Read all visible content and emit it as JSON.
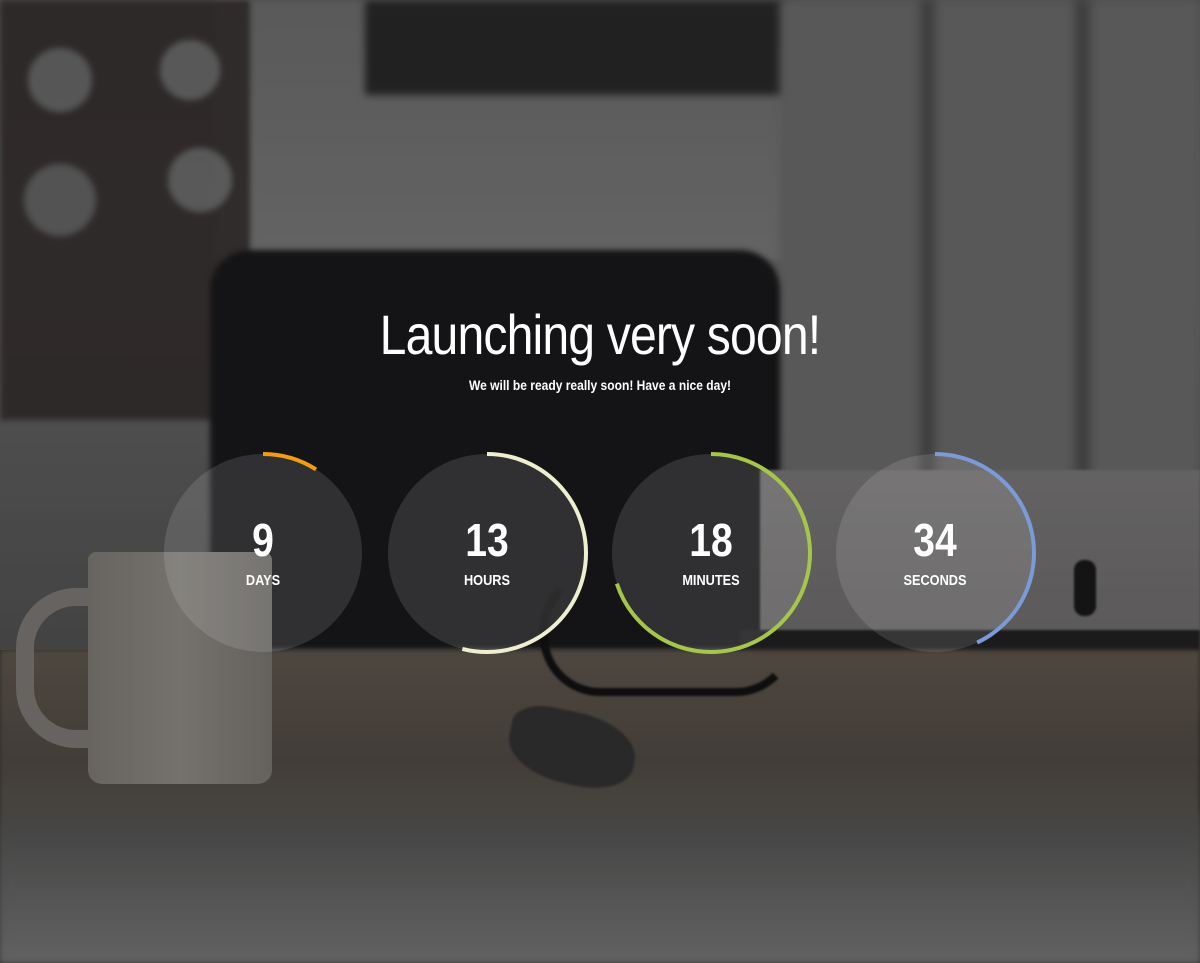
{
  "page": {
    "title": "Launching very soon!",
    "subtitle": "We will be ready really soon! Have a nice day!"
  },
  "countdown": [
    {
      "value": "9",
      "label": "DAYS",
      "progress": 0.09,
      "color": "#f39c12"
    },
    {
      "value": "13",
      "label": "HOURS",
      "progress": 0.54,
      "color": "#eeeed0"
    },
    {
      "value": "18",
      "label": "MINUTES",
      "progress": 0.7,
      "color": "#a5c64a"
    },
    {
      "value": "34",
      "label": "SECONDS",
      "progress": 0.43,
      "color": "#7b9bd8"
    }
  ],
  "colors": {
    "circle_fill": "rgba(255,255,255,0.12)",
    "text": "#ffffff"
  }
}
